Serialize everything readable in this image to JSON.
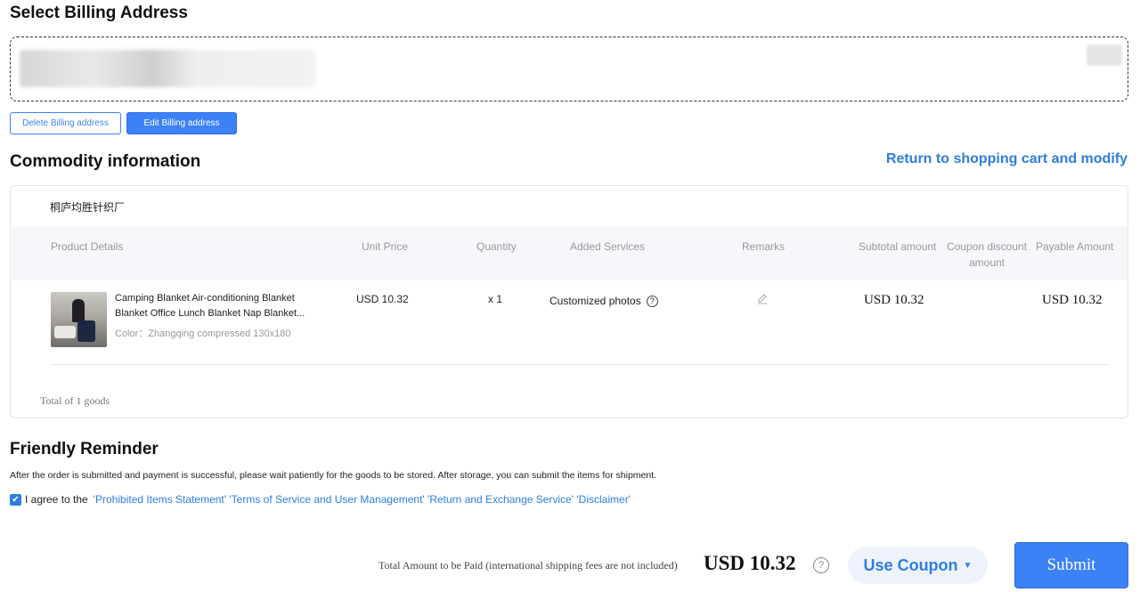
{
  "billing": {
    "title": "Select Billing Address",
    "delete_label": "Delete Billing address",
    "edit_label": "Edit Billing address"
  },
  "commodity": {
    "title": "Commodity information",
    "return_link": "Return to shopping cart and modify",
    "store_name": "桐庐均胜针织厂",
    "headers": {
      "product": "Product Details",
      "unit_price": "Unit Price",
      "quantity": "Quantity",
      "services": "Added Services",
      "remarks": "Remarks",
      "subtotal": "Subtotal amount",
      "coupon": "Coupon discount amount",
      "payable": "Payable Amount"
    },
    "item": {
      "name": "Camping Blanket Air-conditioning Blanket Blanket Office Lunch Blanket Nap Blanket...",
      "color": "Color：Zhangqing compressed 130x180",
      "unit_price": "USD 10.32",
      "quantity": "x 1",
      "service": "Customized photos",
      "subtotal": "USD 10.32",
      "payable": "USD 10.32"
    },
    "total_goods": "Total of 1 goods"
  },
  "reminder": {
    "title": "Friendly Reminder",
    "text": "After the order is submitted and payment is successful, please wait patiently for the goods to be stored. After storage, you can submit the items for shipment.",
    "agree_label": "I agree to the",
    "agree_links": "'Prohibited Items Statement' 'Terms of Service and User Management' 'Return and Exchange Service' 'Disclaimer'",
    "agree_checked": true
  },
  "footer": {
    "total_label": "Total Amount to be Paid (international shipping fees are not included)",
    "total_amount": "USD 10.32",
    "coupon_label": "Use Coupon",
    "submit_label": "Submit"
  },
  "colors": {
    "accent": "#3b82f6",
    "link": "#2f7de1"
  },
  "icons": [
    "help-circle-icon",
    "edit-pencil-icon",
    "checkbox-check-icon",
    "caret-down-icon"
  ]
}
